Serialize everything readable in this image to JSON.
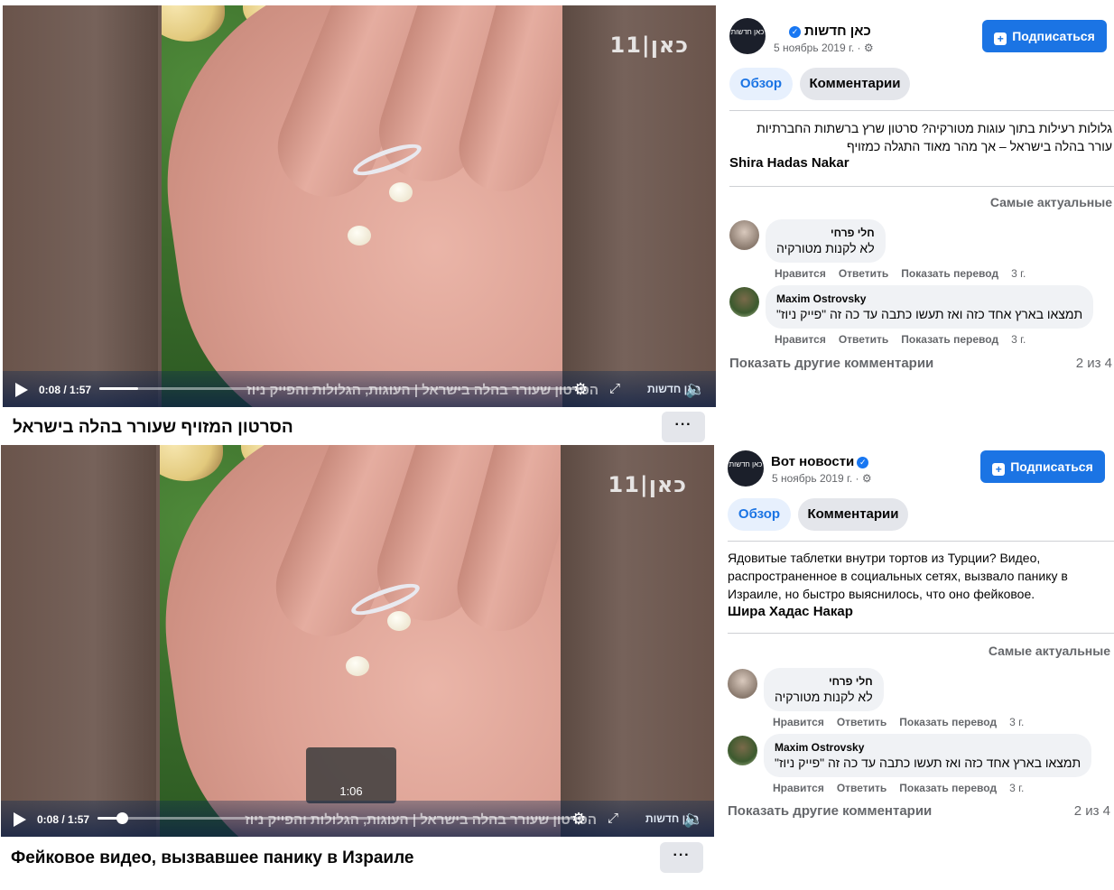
{
  "colors": {
    "accent": "#1b74e4",
    "tab_active_bg": "#e7f0fd",
    "muted": "#65676b"
  },
  "top": {
    "video": {
      "watermark": "כאן|11",
      "time": "0:08 / 1:57",
      "progress": 0.08,
      "ticker": "הסרטון שעורר בהלה בישראל | העוגות, הגלולות והפייק ניוז",
      "badge": "כאן חדשות"
    },
    "title": "הסרטון המזויף שעורר בהלה בישראל",
    "more_label": "···",
    "page": {
      "logo_text": "כאן חדשות",
      "name": "כאן חדשות",
      "date": "5 ноябрь 2019 г. · ⚙"
    },
    "subscribe_label": "Подписаться",
    "tabs": {
      "overview": "Обзор",
      "comments": "Комментарии"
    },
    "description": "גלולות רעילות בתוך עוגות מטורקיה? סרטון שרץ ברשתות החברתיות עורר בהלה בישראל – אך מהר מאוד התגלה כמזויף",
    "author": "Shira Hadas Nakar",
    "sort_label": "Самые актуальные",
    "comments": [
      {
        "name": "חלי פרחי",
        "text": "לא לקנות מטורקיה",
        "like": "Нравится",
        "reply": "Ответить",
        "translate": "Показать перевод",
        "ago": "3 г."
      },
      {
        "name": "Maxim Ostrovsky",
        "text": "תמצאו בארץ אחד כזה ואז תעשו כתבה עד כה זה \"פייק ניוז\"",
        "like": "Нравится",
        "reply": "Ответить",
        "translate": "Показать перевод",
        "ago": "3 г."
      }
    ],
    "more_comments": "Показать другие комментарии",
    "count": "2 из 4"
  },
  "bottom": {
    "video": {
      "watermark": "כאן|11",
      "time": "0:08 / 1:57",
      "progress": 0.05,
      "hover_time": "1:06",
      "ticker": "הסרטון שעורר בהלה בישראל | העוגות, הגלולות והפייק ניוז",
      "badge": "כאן חדשות"
    },
    "title": "Фейковое видео, вызвавшее панику в Израиле",
    "more_label": "···",
    "page": {
      "logo_text": "כאן חדשות",
      "name": "Вот новости",
      "date": "5 ноябрь 2019 г. · ⚙"
    },
    "subscribe_label": "Подписаться",
    "tabs": {
      "overview": "Обзор",
      "comments": "Комментарии"
    },
    "description": "Ядовитые таблетки внутри тортов из Турции? Видео, распространенное в социальных сетях, вызвало панику в Израиле, но быстро выяснилось, что оно фейковое.",
    "author": "Шира Хадас Накар",
    "sort_label": "Самые актуальные",
    "comments": [
      {
        "name": "חלי פרחי",
        "text": "לא לקנות מטורקיה",
        "like": "Нравится",
        "reply": "Ответить",
        "translate": "Показать перевод",
        "ago": "3 г."
      },
      {
        "name": "Maxim Ostrovsky",
        "text": "תמצאו בארץ אחד כזה ואז תעשו כתבה עד כה זה \"פייק ניוז\"",
        "like": "Нравится",
        "reply": "Ответить",
        "translate": "Показать перевод",
        "ago": "3 г."
      }
    ],
    "more_comments": "Показать другие комментарии",
    "count": "2 из 4"
  }
}
